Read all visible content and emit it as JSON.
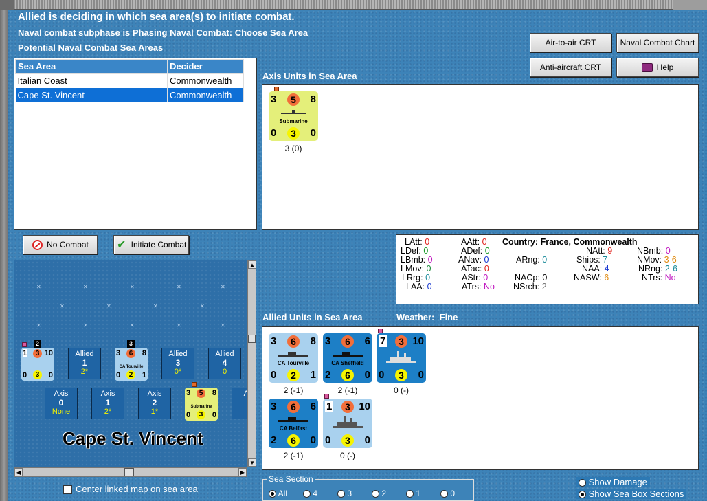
{
  "header": {
    "line1": "Allied is deciding in which sea area(s) to initiate combat.",
    "line2": "Naval combat subphase is Phasing Naval Combat: Choose Sea Area",
    "line3": "Potential Naval Combat Sea Areas"
  },
  "buttons": {
    "air_to_air": "Air-to-air CRT",
    "naval_chart": "Naval Combat Chart",
    "anti_aircraft": "Anti-aircraft CRT",
    "help": "Help",
    "no_combat": "No Combat",
    "initiate_combat": "Initiate Combat"
  },
  "sea_area_table": {
    "headers": [
      "Sea Area",
      "Decider"
    ],
    "rows": [
      {
        "area": "Italian Coast",
        "decider": "Commonwealth"
      },
      {
        "area": "Cape St. Vincent",
        "decider": "Commonwealth"
      }
    ]
  },
  "axis_units": {
    "label": "Axis Units in Sea Area",
    "units": [
      {
        "tl": "3",
        "tc": "5",
        "tr": "8",
        "name": "Submarine",
        "bl": "0",
        "bc": "3",
        "br": "0",
        "caption": "3 (0)"
      }
    ]
  },
  "stats": {
    "LAtt": "0",
    "LDef": "0",
    "LBmb": "0",
    "LMov": "0",
    "LRrg": "0",
    "LAA": "0",
    "AAtt": "0",
    "ADef": "0",
    "ANav": "0",
    "ATac": "0",
    "AStr": "0",
    "ATrs": "No",
    "country_label": "Country:",
    "country": "France, Commonwealth",
    "ARng": "0",
    "NACp": "0",
    "NSrch": "2",
    "NAtt": "9",
    "Ships": "7",
    "NAA": "4",
    "NASW": "6",
    "NBmb": "0",
    "NMov": "3-6",
    "NRng": "2-6",
    "NTrs": "No"
  },
  "stat_labels": {
    "LAtt": "LAtt:",
    "LDef": "LDef:",
    "LBmb": "LBmb:",
    "LMov": "LMov:",
    "LRrg": "LRrg:",
    "LAA": "LAA:",
    "AAtt": "AAtt:",
    "ADef": "ADef:",
    "ANav": "ANav:",
    "ATac": "ATac:",
    "AStr": "AStr:",
    "ATrs": "ATrs:",
    "ARng": "ARng:",
    "NACp": "NACp:",
    "NSrch": "NSrch:",
    "NAtt": "NAtt:",
    "Ships": "Ships:",
    "NAA": "NAA:",
    "NASW": "NASW:",
    "NBmb": "NBmb:",
    "NMov": "NMov:",
    "NRng": "NRng:",
    "NTrs": "NTrs:"
  },
  "allied_units": {
    "label": "Allied Units in Sea Area",
    "weather_label": "Weather:",
    "weather": "Fine",
    "units": [
      {
        "tl": "3",
        "tc": "6",
        "tr": "8",
        "name": "CA Tourville",
        "bl": "0",
        "bc": "2",
        "br": "1",
        "caption": "2 (-1)"
      },
      {
        "tl": "3",
        "tc": "6",
        "tr": "6",
        "name": "CA Sheffield",
        "bl": "2",
        "bc": "6",
        "br": "0",
        "caption": "2 (-1)"
      },
      {
        "tl": "7",
        "tc": "3",
        "tr": "10",
        "name": "",
        "bl": "0",
        "bc": "3",
        "br": "0",
        "caption": "0 (-)"
      },
      {
        "tl": "3",
        "tc": "6",
        "tr": "6",
        "name": "CA Belfast",
        "bl": "2",
        "bc": "6",
        "br": "0",
        "caption": "2 (-1)"
      },
      {
        "tl": "1",
        "tc": "3",
        "tr": "10",
        "name": "",
        "bl": "0",
        "bc": "3",
        "br": "0",
        "caption": "0 (-)"
      }
    ]
  },
  "seamap": {
    "name": "Cape St. Vincent",
    "stack_counts": [
      "2",
      "3"
    ],
    "allied_boxes": [
      {
        "side": "Allied",
        "num": "1",
        "val": "2*"
      },
      {
        "side": "Allied",
        "num": "3",
        "val": "0*"
      },
      {
        "side": "Allied",
        "num": "4",
        "val": "0"
      }
    ],
    "axis_boxes": [
      {
        "side": "Axis",
        "num": "0",
        "val": "None"
      },
      {
        "side": "Axis",
        "num": "1",
        "val": "2*"
      },
      {
        "side": "Axis",
        "num": "2",
        "val": "1*"
      },
      {
        "side": "Ax",
        "num": "",
        "val": ""
      }
    ],
    "minis": [
      {
        "tl": "1",
        "tc": "3",
        "tr": "10",
        "name": "",
        "bl": "0",
        "bc": "3",
        "br": "0"
      },
      {
        "tl": "3",
        "tc": "6",
        "tr": "8",
        "name": "CA Tourville",
        "bl": "0",
        "bc": "2",
        "br": "1"
      },
      {
        "tl": "3",
        "tc": "5",
        "tr": "8",
        "name": "Submarine",
        "bl": "0",
        "bc": "3",
        "br": "0"
      }
    ]
  },
  "center_linked": "Center linked map on sea area",
  "sea_section": {
    "legend": "Sea Section",
    "options": [
      "All",
      "4",
      "3",
      "2",
      "1",
      "0"
    ],
    "selected": "All"
  },
  "show_damage": "Show Damage",
  "show_sea_box": "Show Sea Box Sections"
}
